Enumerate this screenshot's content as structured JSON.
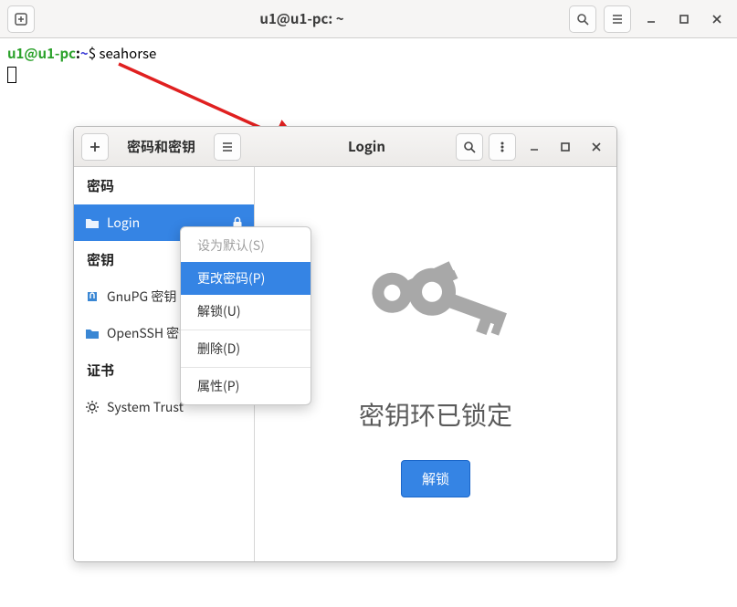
{
  "terminal": {
    "title": "u1@u1-pc: ~",
    "user_host": "u1@u1-pc",
    "colon": ":",
    "path": "~",
    "prompt_char": "$ ",
    "command": "seahorse"
  },
  "seahorse": {
    "title_left": "密码和密钥",
    "title_mid": "Login",
    "sidebar": {
      "sections": {
        "s1": "密码",
        "s2": "密钥",
        "s3": "证书"
      },
      "items": {
        "login": "Login",
        "gnupg": "GnuPG 密钥",
        "openssh": "OpenSSH 密钥",
        "system_trust": "System Trust"
      }
    },
    "content": {
      "heading": "密钥环已锁定",
      "unlock": "解锁"
    }
  },
  "context_menu": {
    "set_default": "设为默认(S)",
    "change_pass": "更改密码(P)",
    "unlock": "解锁(U)",
    "delete": "删除(D)",
    "properties": "属性(P)"
  }
}
